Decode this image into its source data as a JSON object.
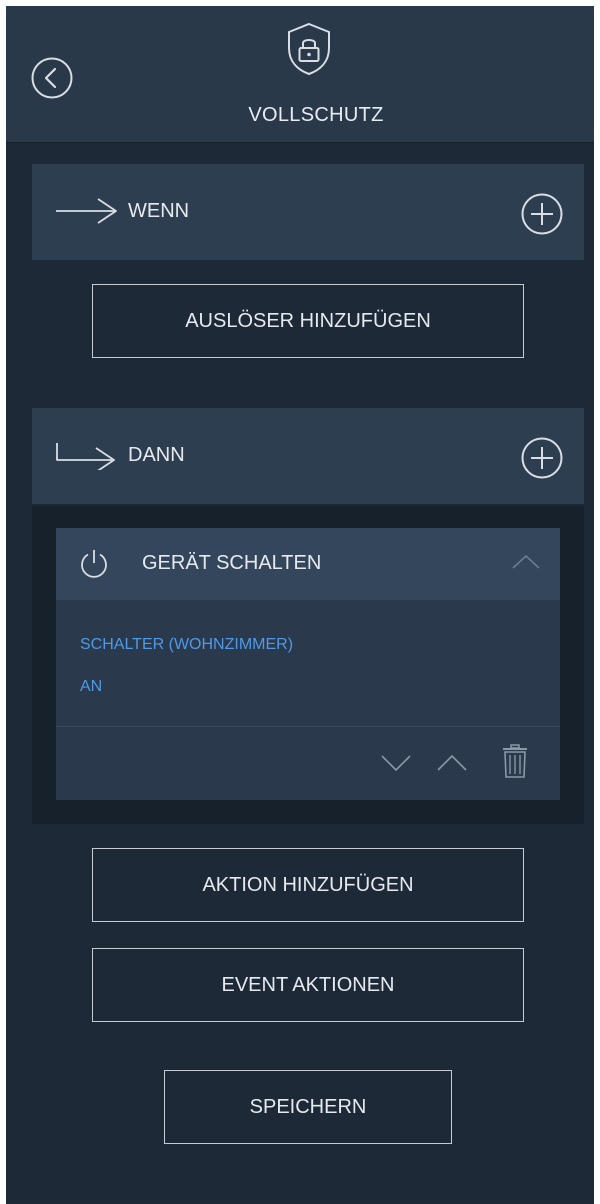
{
  "header": {
    "title": "VOLLSCHUTZ",
    "back_icon": "back-circle-icon",
    "shield_icon": "shield-lock-icon"
  },
  "when": {
    "label": "WENN",
    "arrow_icon": "arrow-right-icon",
    "add_icon": "plus-circle-icon",
    "add_trigger_label": "AUSLÖSER HINZUFÜGEN"
  },
  "then": {
    "label": "DANN",
    "arrow_icon": "turn-right-arrow-icon",
    "add_icon": "plus-circle-icon"
  },
  "action": {
    "title": "GERÄT SCHALTEN",
    "power_icon": "power-icon",
    "device": "SCHALTER (WOHNZIMMER)",
    "state": "AN",
    "accent": "#4e9ae8"
  },
  "buttons": {
    "add_action": "AKTION HINZUFÜGEN",
    "event_actions": "EVENT AKTIONEN",
    "save": "SPEICHERN"
  },
  "colors": {
    "background": "#1d2937",
    "header": "#2a394a",
    "section": "#2e3e51",
    "text": "#e6eaef"
  }
}
